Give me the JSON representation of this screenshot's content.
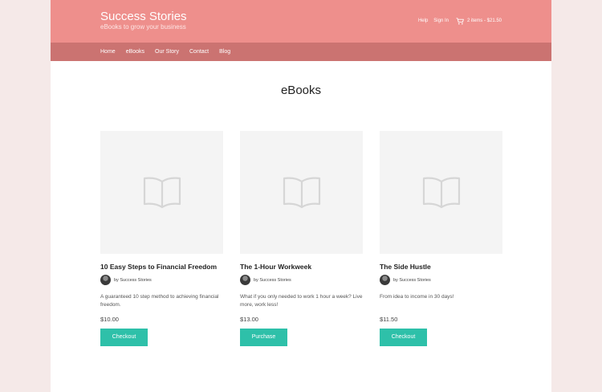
{
  "header": {
    "site_title": "Success Stories",
    "tagline": "eBooks to grow your business",
    "links": {
      "help": "Help",
      "signin": "Sign In",
      "cart": "2 items - $21.50"
    }
  },
  "nav": {
    "items": [
      "Home",
      "eBooks",
      "Our Story",
      "Contact",
      "Blog"
    ]
  },
  "main": {
    "heading": "eBooks"
  },
  "products": [
    {
      "title": "10 Easy Steps to Financial Freedom",
      "author": "by Success Stories",
      "description": "A guaranteed 10 step method to achieving financial freedom.",
      "price": "$10.00",
      "button": "Checkout"
    },
    {
      "title": "The 1-Hour Workweek",
      "author": "by Success Stories",
      "description": "What if you only needed to work 1 hour a week? Live more, work less!",
      "price": "$13.00",
      "button": "Purchase"
    },
    {
      "title": "The Side Hustle",
      "author": "by Success Stories",
      "description": "From idea to income in 30 days!",
      "price": "$11.50",
      "button": "Checkout"
    }
  ],
  "colors": {
    "header_bg": "#ee8f8c",
    "nav_bg": "#cb7371",
    "button_bg": "#2ec0a9",
    "page_bg": "#f5e9e8"
  },
  "icons": {
    "product_placeholder": "book-icon",
    "cart": "cart-icon"
  }
}
